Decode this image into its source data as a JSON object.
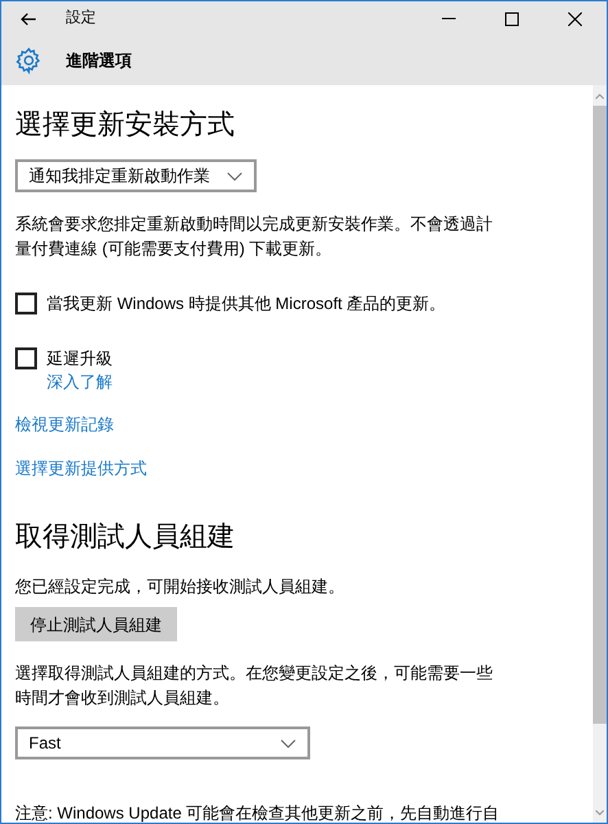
{
  "window": {
    "title": "設定",
    "page_title": "進階選項"
  },
  "sections": [
    {
      "heading": "選擇更新安裝方式",
      "items": [
        {
          "kind": "dropdown",
          "value": "通知我排定重新啟動作業"
        },
        {
          "kind": "text",
          "text": "系統會要求您排定重新啟動時間以完成更新安裝作業。不會透過計量付費連線 (可能需要支付費用) 下載更新。"
        },
        {
          "kind": "checkbox",
          "label": "當我更新 Windows 時提供其他 Microsoft 產品的更新。",
          "checked": false
        },
        {
          "kind": "checkbox",
          "label": "延遲升級",
          "checked": false,
          "link": "深入了解"
        },
        {
          "kind": "link",
          "text": "檢視更新記錄"
        },
        {
          "kind": "link",
          "text": "選擇更新提供方式"
        }
      ]
    },
    {
      "heading": "取得測試人員組建",
      "items": [
        {
          "kind": "text",
          "text": "您已經設定完成，可開始接收測試人員組建。"
        },
        {
          "kind": "button",
          "text": "停止測試人員組建"
        },
        {
          "kind": "text",
          "text": "選擇取得測試人員組建的方式。在您變更設定之後，可能需要一些時間才會收到測試人員組建。"
        },
        {
          "kind": "dropdown",
          "value": "Fast"
        },
        {
          "kind": "note",
          "text": "注意: Windows Update 可能會在檢查其他更新之前，先自動進行自"
        }
      ]
    }
  ]
}
